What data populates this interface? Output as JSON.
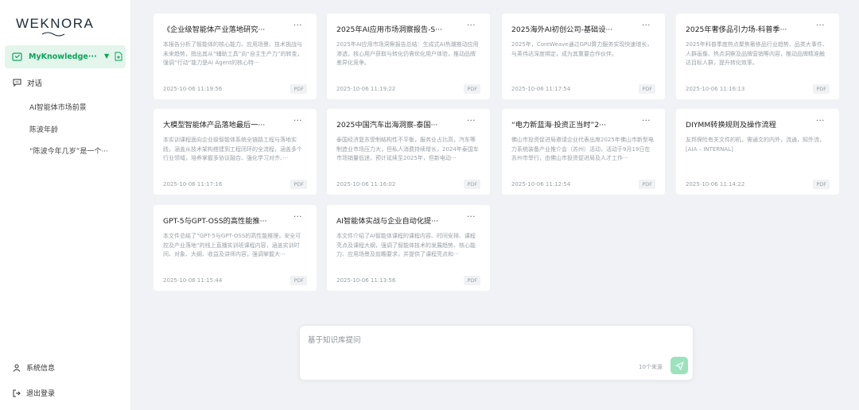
{
  "sidebar": {
    "logo": "WEKNORA",
    "knowledge_base": "MyKnowledge···",
    "chat_label": "对话",
    "conversations": [
      "AI智能体市场前景",
      "陈波年龄",
      "“陈波今年几岁”是一个···"
    ],
    "system_info": "系统信息",
    "logout": "退出登录"
  },
  "cards": [
    {
      "title": "《企业级智能体产业落地研究···",
      "desc": "本报告分析了智能体的核心能力、应用场景、技术挑战与未来趋势，指出其从“辅助工具”向“自主生产力”的转变，强调“行动”能力是AI Agent的核心特···",
      "date": "2025-10-06 11:19:56",
      "type": "PDF"
    },
    {
      "title": "2025年AI应用市场洞察报告-S···",
      "desc": "2025年AI应用市场洞察报告总结：生成式AI热潮推动应用渗透，核心用户获取与转化仍需优化用户体验，推动品牌差异化竞争。",
      "date": "2025-10-06 11:19:22",
      "type": "PDF"
    },
    {
      "title": "2025海外AI初创公司-基础设···",
      "desc": "2025年，CoreWeave通过GPU算力服务实现快速增长，与英伟达深度绑定，成为其重要合作伙伴。",
      "date": "2025-10-06 11:17:54",
      "type": "PDF"
    },
    {
      "title": "2025年奢侈品引力场-科普季···",
      "desc": "2025年科普季度热点聚焦奢侈品行业趋势、品类大事件、人群画像、热点洞察及品牌营销等内容，推动品牌精准触达目标人群，提升转化效率。",
      "date": "2025-10-06 11:16:13",
      "type": "PDF"
    },
    {
      "title": "大模型智能体产品落地最后一···",
      "desc": "本实训课程面向企业级智能体系统全链路工程与落地实践，涵盖从技术架构搭建到工程闭环的全流程，涵盖多个行业领域，培养掌握多协议融合、强化学习对齐、···",
      "date": "2025-10-06 11:17:16",
      "type": "PDF"
    },
    {
      "title": "2025中国汽车出海洞察-泰国···",
      "desc": "泰国经济复苏受制结构性不平衡，服务业占比高，汽车等制造业市场压力大，但私人消费持续增长，2024年泰国车市场销量低迷，预计延续至2025年，但新电动···",
      "date": "2025-10-06 11:16:02",
      "type": "PDF"
    },
    {
      "title": "“电力新蓝海·投资正当时”2···",
      "desc": "佛山市投资促进局邀请企业代表出席2025年佛山市新型电力系统装备产业推介会（苏州）活动，活动于9月19日在苏州市举行，由佛山市投资促进局及人才工作···",
      "date": "2025-10-06 11:12:54",
      "type": "PDF"
    },
    {
      "title": "DIYMM转换规则及操作流程",
      "desc": "友邦保险有关文件的机，需通文的内外，流通，知外流，[AIA – INTERNAL]",
      "date": "2025-10-06 11:14:22",
      "type": "PDF"
    },
    {
      "title": "GPT-5与GPT-OSS的高性能推···",
      "desc": "本文件总结了“GPT-5与GPT-OSS的高性能推理，安全可控及产业落地”的线上直播实训班课程内容，涵盖实训时间、对象、大纲、收益及讲师内容，强调掌握大···",
      "date": "2025-10-06 11:15:44",
      "type": "PDF"
    },
    {
      "title": "AI智能体实战与企业自动化提···",
      "desc": "本文件介绍了AI智能体课程的课程内容、时间安排、课程亮点及课程大纲，强调了智能体技术的发展趋势、核心能力、应用场景及前瞻要求，并提供了课程亮点和···",
      "date": "2025-10-06 11:13:56",
      "type": "PDF"
    }
  ],
  "chat_input": {
    "placeholder": "基于知识库提问",
    "source_count": "10个来源"
  },
  "colors": {
    "accent": "#07a65a",
    "accent_light_bg": "#e4f5ec",
    "send_button": "#9be3bc",
    "background": "#f0f2f5"
  }
}
